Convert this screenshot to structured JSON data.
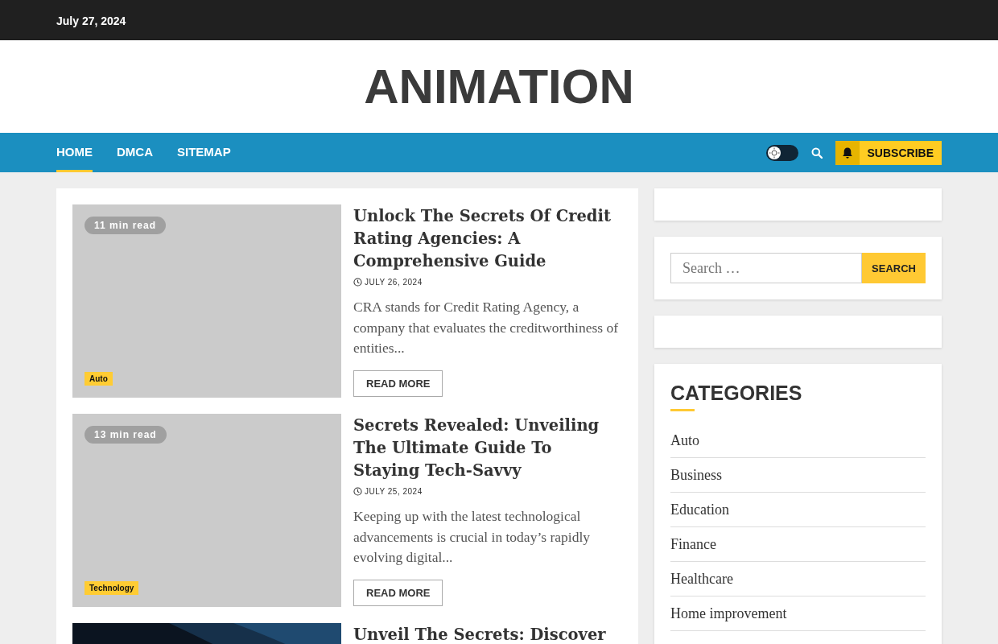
{
  "top_bar": {
    "date": "July 27, 2024"
  },
  "site_title": "ANIMATION",
  "nav": {
    "items": [
      {
        "label": "HOME",
        "selected": true
      },
      {
        "label": "DMCA",
        "selected": false
      },
      {
        "label": "SITEMAP",
        "selected": false
      }
    ],
    "dark_mode": false,
    "subscribe": "SUBSCRIBE"
  },
  "posts": [
    {
      "read_time": "11 min read",
      "category": "Auto",
      "title": "Unlock The Secrets Of Credit Rating Agencies: A Comprehensive Guide",
      "date": "JULY 26, 2024",
      "excerpt": "CRA stands for Credit Rating Agency, a company that evaluates the creditworthiness of entities...",
      "button": "READ MORE",
      "kind": "placeholder"
    },
    {
      "read_time": "13 min read",
      "category": "Technology",
      "title": "Secrets Revealed: Unveiling The Ultimate Guide To Staying Tech-Savvy",
      "date": "JULY 25, 2024",
      "excerpt": "Keeping up with the latest technological advancements is crucial in today’s rapidly evolving digital...",
      "button": "READ MORE",
      "kind": "placeholder"
    },
    {
      "title": "Unveil The Secrets: Discover",
      "kind": "picture"
    }
  ],
  "sidebar": {
    "search": {
      "placeholder": "Search …",
      "button": "SEARCH"
    },
    "categories": {
      "heading": "CATEGORIES",
      "items": [
        "Auto",
        "Business",
        "Education",
        "Finance",
        "Healthcare",
        "Home improvement"
      ]
    }
  }
}
